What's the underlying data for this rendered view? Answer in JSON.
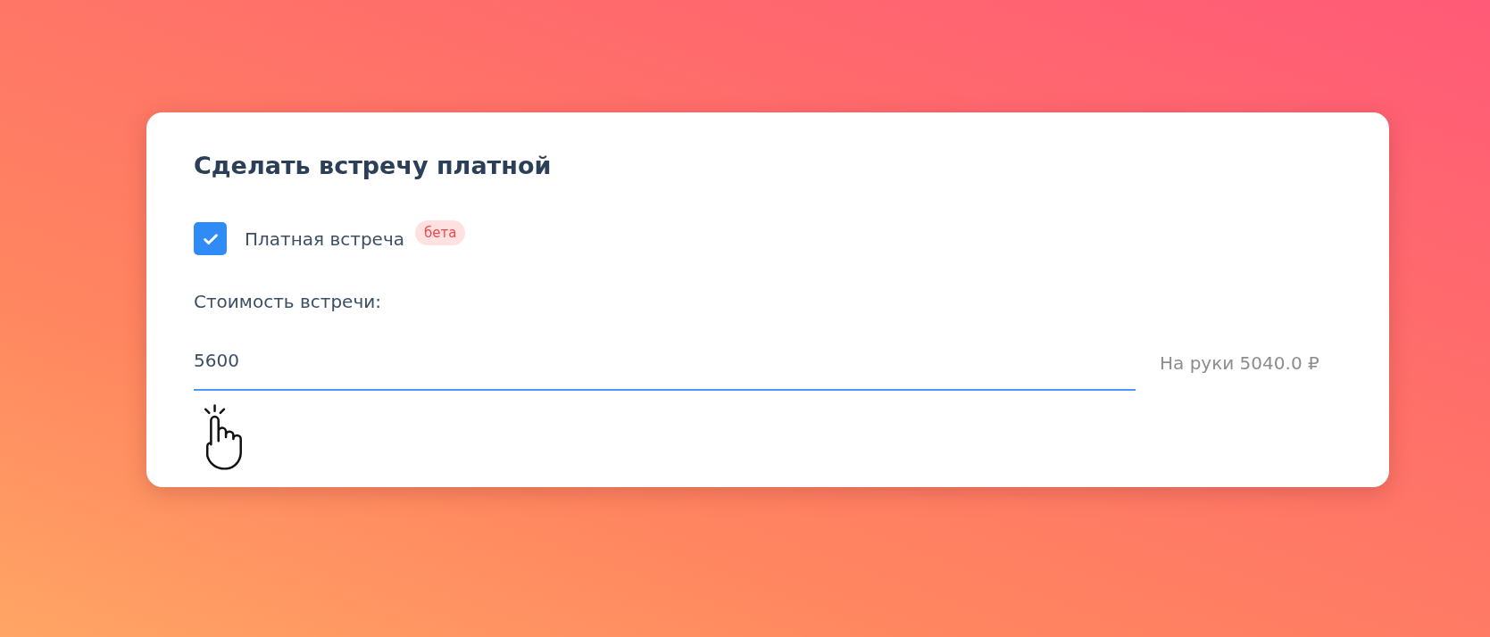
{
  "card": {
    "title": "Сделать встречу платной",
    "paid_option": {
      "label": "Платная встреча",
      "checked": true,
      "badge": "бета"
    },
    "price": {
      "label": "Стоимость встречи:",
      "value": "5600",
      "focused": true,
      "net_amount": "На руки 5040.0 ₽"
    }
  }
}
